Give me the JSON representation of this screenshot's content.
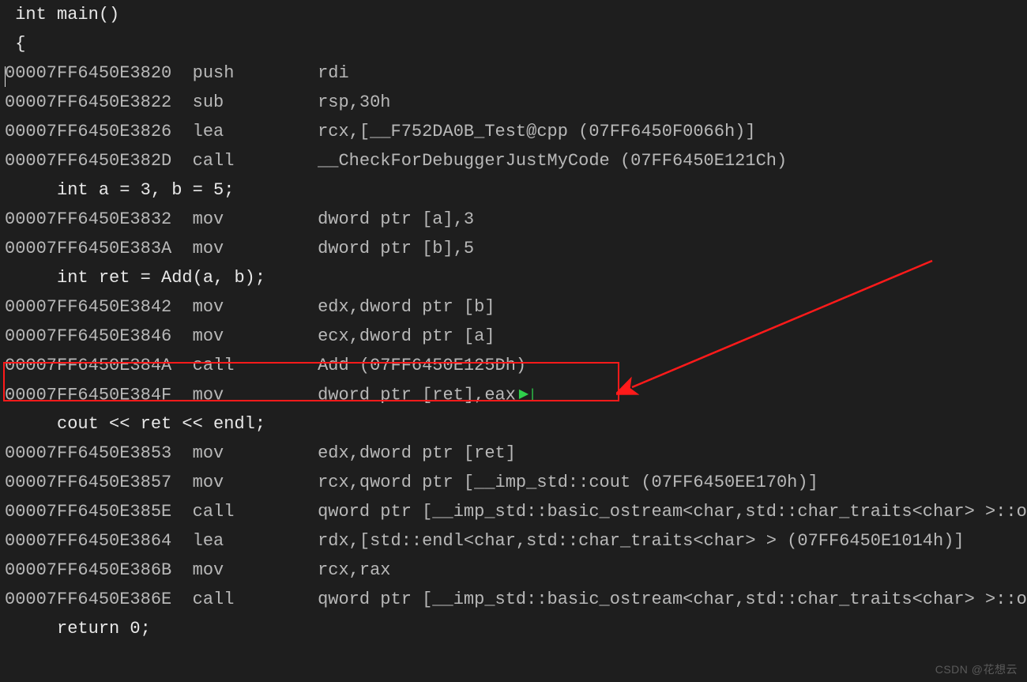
{
  "watermark": "CSDN @花想云",
  "source": {
    "main_sig": " int main()",
    "brace_open": " {",
    "decl_ab": "     int a = 3, b = 5;",
    "blank": "",
    "decl_ret": "     int ret = Add(a, b);",
    "cout": "     cout << ret << endl;",
    "return0": "     return 0;"
  },
  "asm": {
    "l1": {
      "addr": "00007FF6450E3820",
      "mnem": "push",
      "ops": "rdi"
    },
    "l2": {
      "addr": "00007FF6450E3822",
      "mnem": "sub",
      "ops": "rsp,30h"
    },
    "l3": {
      "addr": "00007FF6450E3826",
      "mnem": "lea",
      "ops": "rcx,[__F752DA0B_Test@cpp (07FF6450F0066h)]"
    },
    "l4": {
      "addr": "00007FF6450E382D",
      "mnem": "call",
      "ops": "__CheckForDebuggerJustMyCode (07FF6450E121Ch)"
    },
    "l5": {
      "addr": "00007FF6450E3832",
      "mnem": "mov",
      "ops": "dword ptr [a],3"
    },
    "l6": {
      "addr": "00007FF6450E383A",
      "mnem": "mov",
      "ops": "dword ptr [b],5"
    },
    "l7": {
      "addr": "00007FF6450E3842",
      "mnem": "mov",
      "ops": "edx,dword ptr [b]"
    },
    "l8": {
      "addr": "00007FF6450E3846",
      "mnem": "mov",
      "ops": "ecx,dword ptr [a]"
    },
    "l9": {
      "addr": "00007FF6450E384A",
      "mnem": "call",
      "ops": "Add (07FF6450E125Dh)"
    },
    "l10": {
      "addr": "00007FF6450E384F",
      "mnem": "mov",
      "ops": "dword ptr [ret],eax"
    },
    "l11": {
      "addr": "00007FF6450E3853",
      "mnem": "mov",
      "ops": "edx,dword ptr [ret]"
    },
    "l12": {
      "addr": "00007FF6450E3857",
      "mnem": "mov",
      "ops": "rcx,qword ptr [__imp_std::cout (07FF6450EE170h)]"
    },
    "l13": {
      "addr": "00007FF6450E385E",
      "mnem": "call",
      "ops": "qword ptr [__imp_std::basic_ostream<char,std::char_traits<char> >::operator<<"
    },
    "l14": {
      "addr": "00007FF6450E3864",
      "mnem": "lea",
      "ops": "rdx,[std::endl<char,std::char_traits<char> > (07FF6450E1014h)]"
    },
    "l15": {
      "addr": "00007FF6450E386B",
      "mnem": "mov",
      "ops": "rcx,rax"
    },
    "l16": {
      "addr": "00007FF6450E386E",
      "mnem": "call",
      "ops": "qword ptr [__imp_std::basic_ostream<char,std::char_traits<char> >::operator<<"
    }
  }
}
